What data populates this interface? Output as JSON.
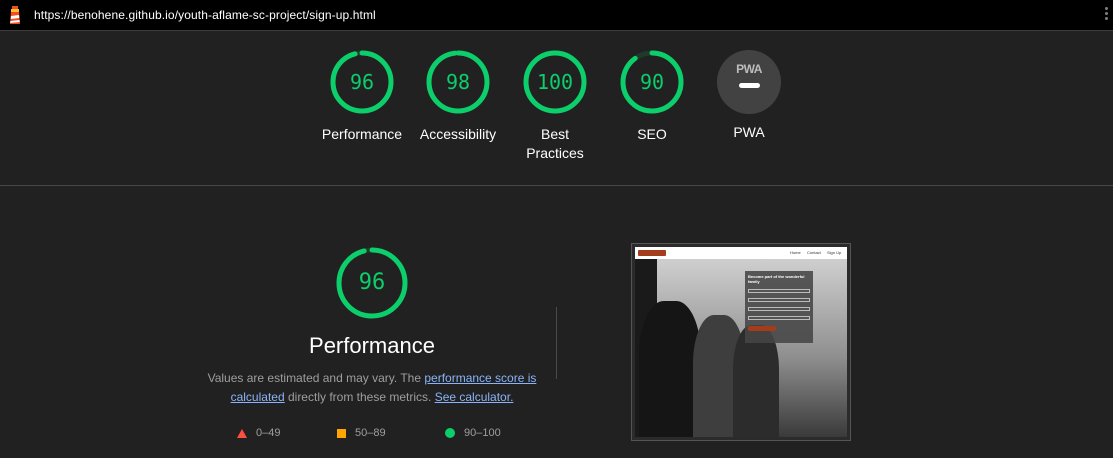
{
  "url_bar": {
    "url": "https://benohene.github.io/youth-aflame-sc-project/sign-up.html"
  },
  "colors": {
    "pass": "#0cce6b",
    "average": "#ffa400",
    "fail": "#ff4e42",
    "link": "#8ab4f8"
  },
  "categories": [
    {
      "id": "performance",
      "score": 96,
      "label": "Performance"
    },
    {
      "id": "accessibility",
      "score": 98,
      "label": "Accessibility"
    },
    {
      "id": "best-practices",
      "score": 100,
      "label_line1": "Best",
      "label_line2": "Practices"
    },
    {
      "id": "seo",
      "score": 90,
      "label": "SEO"
    },
    {
      "id": "pwa",
      "badge_text": "PWA",
      "label": "PWA"
    }
  ],
  "performance": {
    "score": 96,
    "title": "Performance",
    "desc_1": "Values are estimated and may vary. The ",
    "link_1": "performance score is calculated",
    "desc_2": " directly from these metrics. ",
    "link_2": "See calculator."
  },
  "legend": [
    {
      "icon": "triangle-icon",
      "range": "0–49"
    },
    {
      "icon": "square-icon",
      "range": "50–89"
    },
    {
      "icon": "circle-icon",
      "range": "90–100"
    }
  ],
  "thumbnail": {
    "nav_links": [
      "Home",
      "Contact",
      "Sign Up"
    ],
    "form_title": "Become part of the wonderful family"
  }
}
